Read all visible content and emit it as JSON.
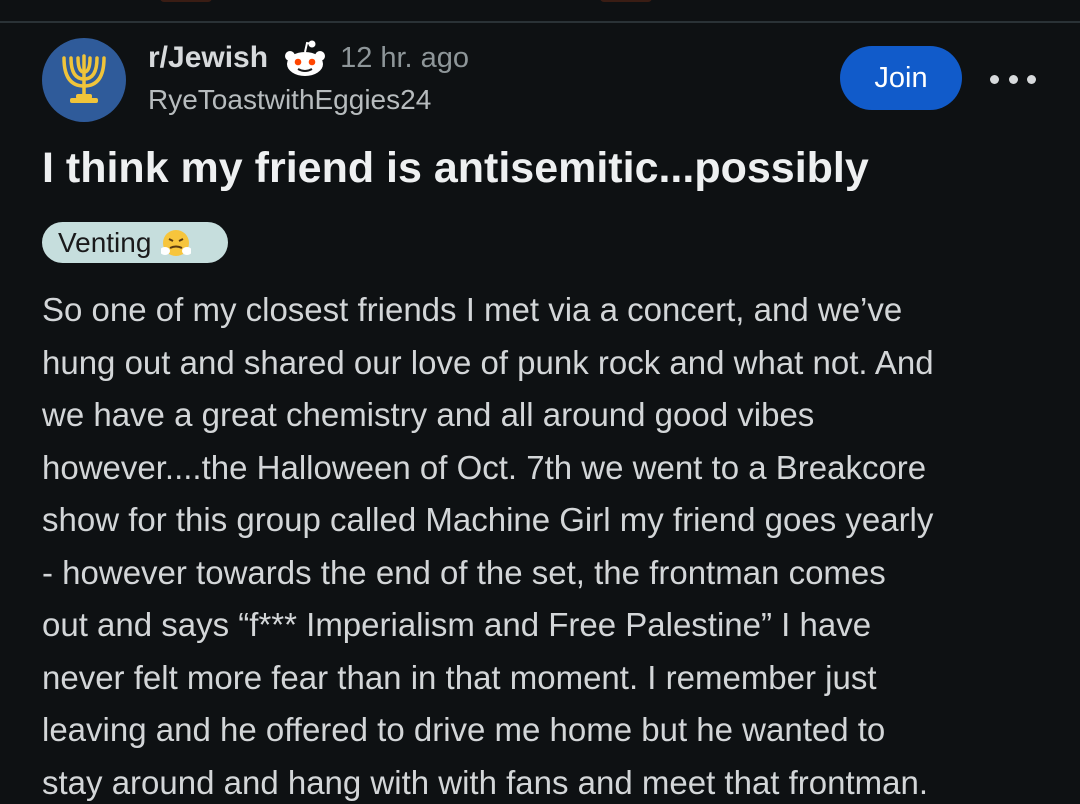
{
  "post": {
    "subreddit": "r/Jewish",
    "time_ago": "12 hr. ago",
    "author": "RyeToastwithEggies24",
    "join_label": "Join",
    "title": "I think my friend is antisemitic...possibly",
    "flair": "Venting",
    "body_lines": [
      "So one of my closest friends I met via a concert, and we’ve",
      "hung out and shared our love of punk rock and what not. And",
      "we have a great chemistry and all around good vibes",
      "however....the Halloween of Oct. 7th we went to a Breakcore",
      "show for this group called Machine Girl my friend goes yearly",
      "- however towards the end of the set, the frontman comes",
      "out and says “f*** Imperialism and Free Palestine” I have",
      "never felt more fear than in that moment. I remember just",
      "leaving and he offered to drive me home but he wanted to",
      "stay around and hang with with fans and meet that frontman."
    ]
  },
  "icons": {
    "avatar": "menorah-icon",
    "mod_badge": "snoo-icon",
    "more": "more-options-icon",
    "flair_emoji": "steam-face-emoji-icon"
  },
  "colors": {
    "background": "#0e1113",
    "join_button": "#115bca",
    "avatar_bg": "#2f5b9a",
    "menorah": "#f0c43a",
    "flair_bg": "#c6dedd"
  }
}
